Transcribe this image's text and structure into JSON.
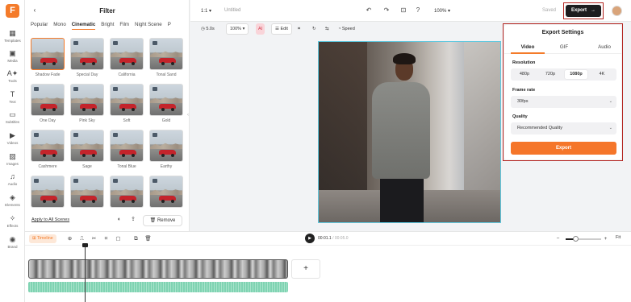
{
  "rail": {
    "logo": "F",
    "items": [
      {
        "label": "Templates",
        "icon": "templates-icon"
      },
      {
        "label": "Media",
        "icon": "media-icon"
      },
      {
        "label": "Tools",
        "icon": "ai-tools-icon"
      },
      {
        "label": "Text",
        "icon": "text-icon"
      },
      {
        "label": "Subtitles",
        "icon": "subtitles-icon"
      },
      {
        "label": "Videos",
        "icon": "videos-icon"
      },
      {
        "label": "Images",
        "icon": "images-icon"
      },
      {
        "label": "Audio",
        "icon": "audio-icon"
      },
      {
        "label": "Elements",
        "icon": "elements-icon"
      },
      {
        "label": "Effects",
        "icon": "effects-icon"
      },
      {
        "label": "Brand",
        "icon": "brand-icon"
      }
    ]
  },
  "filter_panel": {
    "title": "Filter",
    "tabs": [
      "Popular",
      "Mono",
      "Cinematic",
      "Bright",
      "Film",
      "Night Scene",
      "P"
    ],
    "active_tab": "Cinematic",
    "filters": [
      "Shadow Fade",
      "Special Day",
      "California",
      "Tonal Sand",
      "One Day",
      "Pink Sky",
      "Soft",
      "Gold",
      "Cashmere",
      "Sage",
      "Tonal Blue",
      "Earthy",
      "",
      "",
      "",
      ""
    ],
    "selected_filter": "Shadow Fade",
    "apply_all": "Apply to All Scenes",
    "remove": "Remove"
  },
  "topbar": {
    "ratio": "1:1",
    "title": "Untitled",
    "zoom": "100%",
    "saved": "Saved",
    "export": "Export"
  },
  "toolbar": {
    "duration": "5.0s",
    "zoom": "100%",
    "ai": "AI",
    "edit": "Edit",
    "speed": "Speed"
  },
  "export_settings": {
    "title": "Export Settings",
    "tabs": [
      "Video",
      "GIF",
      "Audio"
    ],
    "active_tab": "Video",
    "resolution_label": "Resolution",
    "resolutions": [
      "480p",
      "720p",
      "1080p",
      "4K"
    ],
    "selected_resolution": "1080p",
    "frame_rate_label": "Frame rate",
    "frame_rate": "30fps",
    "quality_label": "Quality",
    "quality": "Recommended Quality",
    "export_button": "Export"
  },
  "timeline": {
    "label": "Timeline",
    "current_time": "00:01.1",
    "total_time": "/ 00:05.0",
    "fit": "Fit",
    "add": "+"
  },
  "colors": {
    "accent": "#f47b2a",
    "highlight_outline": "#b3241f",
    "canvas_selection": "#60c9e0"
  }
}
